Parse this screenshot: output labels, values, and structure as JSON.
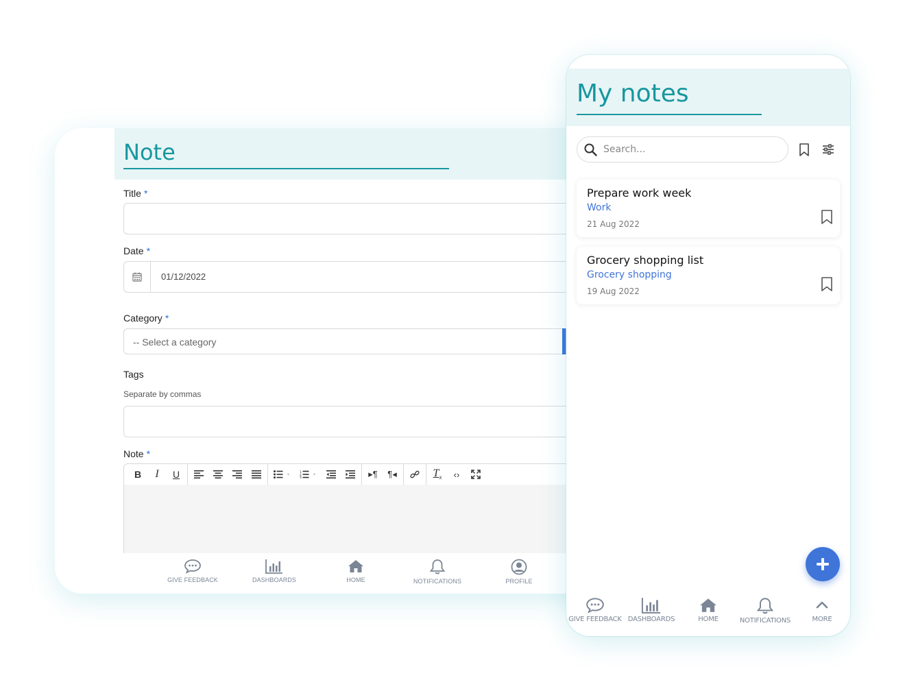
{
  "note_form": {
    "title": "Note",
    "fields": {
      "title_label": "Title",
      "date_label": "Date",
      "date_value": "01/12/2022",
      "category_label": "Category",
      "category_value": "-- Select a category",
      "tags_label": "Tags",
      "tags_hint": "Separate by commas",
      "note_label": "Note",
      "required_mark": "*"
    },
    "editor_toolbar": [
      "bold-icon",
      "italic-icon",
      "underline-icon",
      "align-left-icon",
      "align-center-icon",
      "align-right-icon",
      "align-justify-icon",
      "bullet-list-icon",
      "numbered-list-icon",
      "outdent-icon",
      "indent-icon",
      "ltr-icon",
      "rtl-icon",
      "link-icon",
      "clear-format-icon",
      "code-view-icon",
      "fullscreen-icon"
    ],
    "bottom_nav": [
      {
        "label": "GIVE FEEDBACK",
        "icon": "chat-bubble-icon"
      },
      {
        "label": "DASHBOARDS",
        "icon": "bar-chart-icon"
      },
      {
        "label": "HOME",
        "icon": "home-icon"
      },
      {
        "label": "NOTIFICATIONS",
        "icon": "bell-icon"
      },
      {
        "label": "PROFILE",
        "icon": "user-circle-icon"
      }
    ]
  },
  "my_notes": {
    "title": "My notes",
    "search_placeholder": "Search...",
    "notes": [
      {
        "title": "Prepare work week",
        "category": "Work",
        "date": "21 Aug 2022"
      },
      {
        "title": "Grocery shopping list",
        "category": "Grocery shopping",
        "date": "19 Aug 2022"
      }
    ],
    "bottom_nav": [
      {
        "label": "GIVE FEEDBACK",
        "icon": "chat-bubble-icon"
      },
      {
        "label": "DASHBOARDS",
        "icon": "bar-chart-icon"
      },
      {
        "label": "HOME",
        "icon": "home-icon"
      },
      {
        "label": "NOTIFICATIONS",
        "icon": "bell-icon"
      },
      {
        "label": "MORE",
        "icon": "chevron-up-icon"
      }
    ]
  },
  "colors": {
    "accent_teal": "#17979f",
    "header_bg": "#e8f5f6",
    "primary_blue": "#3f74d8",
    "nav_gray": "#7a8595"
  }
}
